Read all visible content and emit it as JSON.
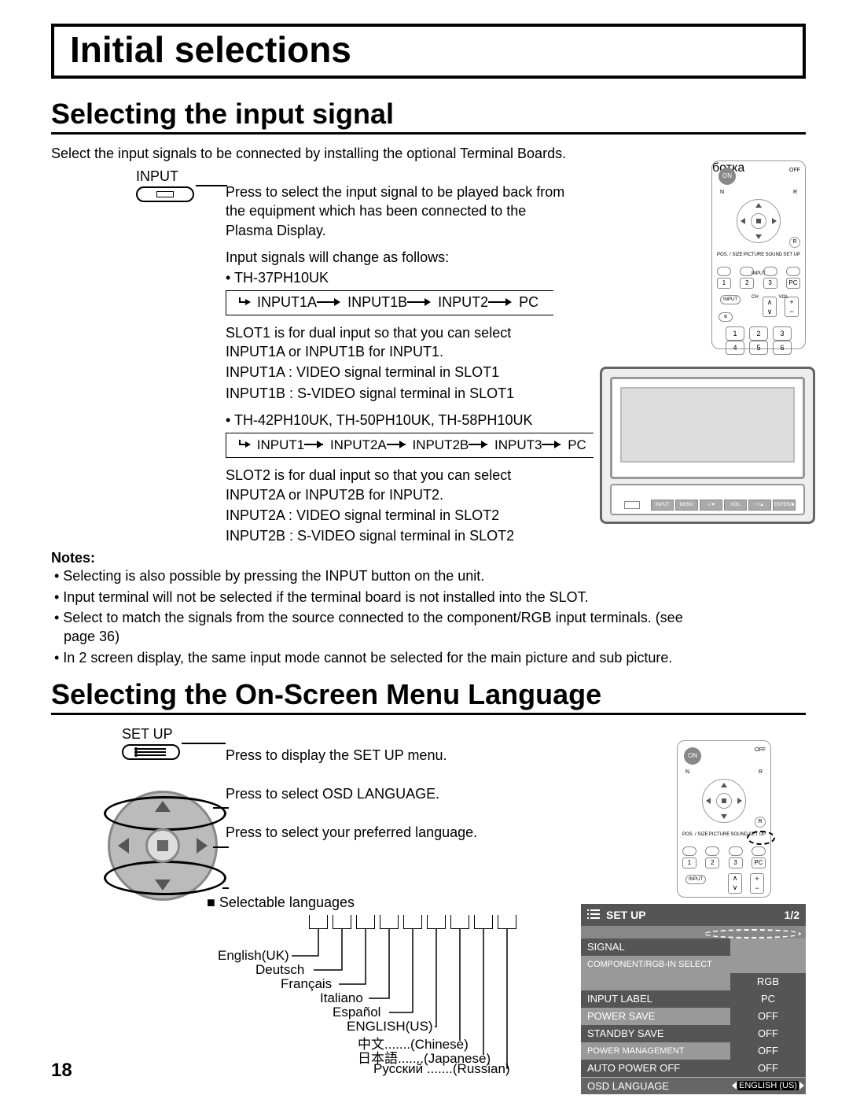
{
  "page": {
    "number": "18"
  },
  "title": "Initial selections",
  "section1": {
    "heading": "Selecting the input signal",
    "intro": "Select the input signals to be connected by installing the optional Terminal Boards.",
    "input_label": "INPUT",
    "press_desc": "Press to select the input signal to be played back from the equipment which has been connected to the Plasma Display.",
    "change_intro": "Input signals will change as follows:",
    "model_a": "• TH-37PH10UK",
    "seq_a": [
      "INPUT1A",
      "INPUT1B",
      "INPUT2",
      "PC"
    ],
    "slot1_desc": "SLOT1 is for dual input so that you can select INPUT1A or INPUT1B for INPUT1.",
    "slot1_a": "INPUT1A :  VIDEO signal terminal in SLOT1",
    "slot1_b": "INPUT1B :  S-VIDEO signal terminal in SLOT1",
    "model_b": "• TH-42PH10UK, TH-50PH10UK, TH-58PH10UK",
    "seq_b": [
      "INPUT1",
      "INPUT2A",
      "INPUT2B",
      "INPUT3",
      "PC"
    ],
    "slot2_desc": "SLOT2 is for dual input so that you can select INPUT2A or INPUT2B for INPUT2.",
    "slot2_a": "INPUT2A :  VIDEO signal terminal in SLOT2",
    "slot2_b": "INPUT2B :  S-VIDEO signal terminal in SLOT2",
    "notes_head": "Notes:",
    "notes": [
      "• Selecting is also possible by pressing the INPUT button on the unit.",
      "• Input terminal will not be selected if the terminal board is not installed into the SLOT.",
      "• Select to match the signals from the source connected to the component/RGB input terminals. (see page 36)",
      "• In 2 screen display, the same input mode cannot be selected for the main picture and sub picture."
    ]
  },
  "section2": {
    "heading": "Selecting the On-Screen Menu Language",
    "setup_label": "SET UP",
    "step1": "Press to display the SET UP menu.",
    "step2": "Press to select OSD LANGUAGE.",
    "step3": "Press to select your preferred language.",
    "selectable_head": "Selectable languages",
    "languages": [
      {
        "name": "English(UK)"
      },
      {
        "name": "Deutsch"
      },
      {
        "name": "Français"
      },
      {
        "name": "Italiano"
      },
      {
        "name": "Español"
      },
      {
        "name": "ENGLISH(US)"
      },
      {
        "name": "中文",
        "note": ".......(Chinese)"
      },
      {
        "name": "日本語",
        "note": ".......(Japanese)"
      },
      {
        "name": "Русский",
        "note": ".......(Russian)"
      }
    ]
  },
  "remote": {
    "on": "ON",
    "off": "OFF",
    "n": "N",
    "r": "R",
    "row_top": [
      "POS. / SIZE",
      "PICTURE",
      "SOUND",
      "SET UP"
    ],
    "input_section": "INPUT",
    "row_num": [
      "1",
      "2",
      "3",
      "PC"
    ],
    "input_btn": "INPUT",
    "ch": "CH",
    "vol": "VOL",
    "keypad": [
      "1",
      "2",
      "3",
      "4",
      "5",
      "6"
    ]
  },
  "tv_panel": [
    "INPUT",
    "MENU",
    "−/▼",
    "VOL",
    "+/▲",
    "ENTER/■"
  ],
  "osd": {
    "title": "SET UP",
    "page": "1/2",
    "rows": [
      {
        "l": "SIGNAL",
        "r": ""
      },
      {
        "l": "COMPONENT/RGB-IN SELECT",
        "r": ""
      },
      {
        "l": "",
        "r": "RGB"
      },
      {
        "l": "INPUT LABEL",
        "r": "PC"
      },
      {
        "l": "POWER SAVE",
        "r": "OFF"
      },
      {
        "l": "STANDBY SAVE",
        "r": "OFF"
      },
      {
        "l": "POWER MANAGEMENT",
        "r": "OFF"
      },
      {
        "l": "AUTO POWER OFF",
        "r": "OFF"
      },
      {
        "l": "OSD LANGUAGE",
        "r": "ENGLISH (US)"
      }
    ]
  }
}
